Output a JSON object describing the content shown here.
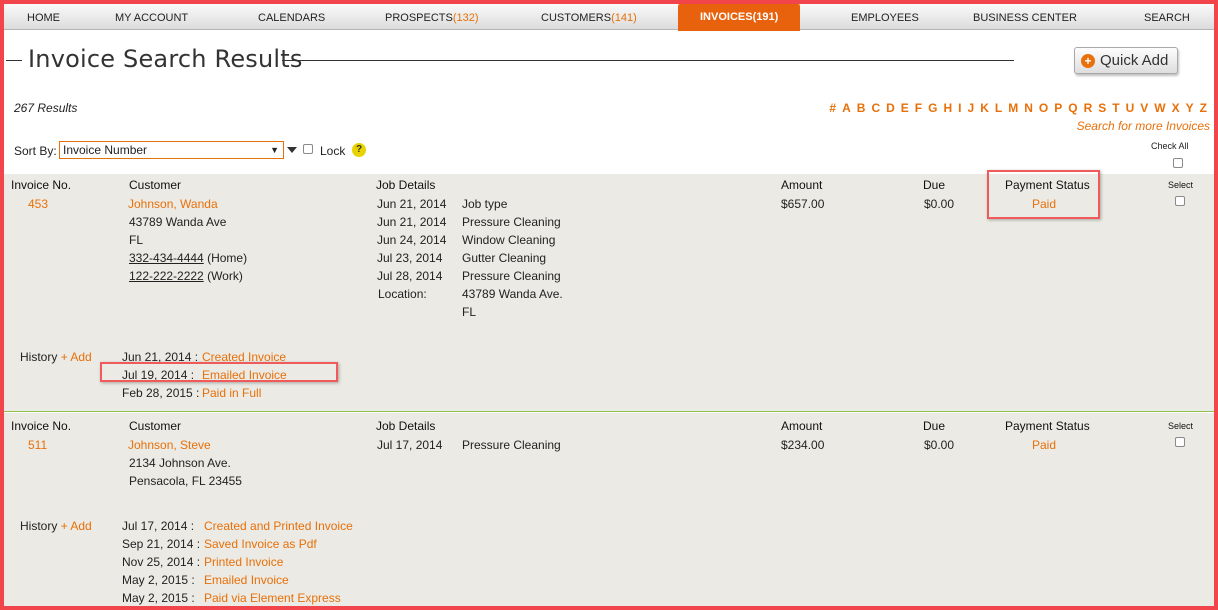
{
  "nav": {
    "items": [
      {
        "label": "HOME",
        "count": ""
      },
      {
        "label": "MY ACCOUNT",
        "count": ""
      },
      {
        "label": "CALENDARS",
        "count": ""
      },
      {
        "label": "PROSPECTS",
        "count": "(132)"
      },
      {
        "label": "CUSTOMERS",
        "count": "(141)"
      },
      {
        "label": "INVOICES",
        "count": "(191)"
      },
      {
        "label": "EMPLOYEES",
        "count": ""
      },
      {
        "label": "BUSINESS CENTER",
        "count": ""
      },
      {
        "label": "SEARCH",
        "count": ""
      }
    ],
    "active": "INVOICES"
  },
  "page": {
    "title": "Invoice Search Results",
    "quick_add": "Quick Add",
    "results_count": "267 Results",
    "alphabet": [
      "#",
      "A",
      "B",
      "C",
      "D",
      "E",
      "F",
      "G",
      "H",
      "I",
      "J",
      "K",
      "L",
      "M",
      "N",
      "O",
      "P",
      "Q",
      "R",
      "S",
      "T",
      "U",
      "V",
      "W",
      "X",
      "Y",
      "Z"
    ],
    "more_link": "Search for more Invoices"
  },
  "sort": {
    "label": "Sort By:",
    "selected": "Invoice Number",
    "lock_label": "Lock",
    "help_icon": "?",
    "check_all": "Check All"
  },
  "columns": {
    "invoice_no": "Invoice No.",
    "customer": "Customer",
    "job_details": "Job Details",
    "amount": "Amount",
    "due": "Due",
    "payment_status": "Payment Status",
    "select": "Select"
  },
  "invoices": [
    {
      "number": "453",
      "customer_name": "Johnson, Wanda",
      "address_lines": [
        "43789 Wanda Ave",
        "FL"
      ],
      "phones": [
        {
          "number": "332-434-4444",
          "type": "(Home)"
        },
        {
          "number": "122-222-2222",
          "type": "(Work)"
        }
      ],
      "jobs": [
        {
          "date": "Jun 21, 2014",
          "type": "Job type"
        },
        {
          "date": "Jun 21, 2014",
          "type": "Pressure Cleaning"
        },
        {
          "date": "Jun 24, 2014",
          "type": "Window Cleaning"
        },
        {
          "date": "Jul 23, 2014",
          "type": "Gutter Cleaning"
        },
        {
          "date": "Jul 28, 2014",
          "type": "Pressure Cleaning"
        }
      ],
      "location_label": "Location:",
      "location_lines": [
        "43789 Wanda Ave.",
        "FL"
      ],
      "amount": "$657.00",
      "due": "$0.00",
      "status": "Paid",
      "history_label": "History",
      "history_add": "+ Add",
      "history": [
        {
          "date": "Jun 21, 2014 :",
          "event": "Created Invoice"
        },
        {
          "date": "Jul 19, 2014 :",
          "event": "Emailed Invoice"
        },
        {
          "date": "Feb 28, 2015 :",
          "event": "Paid in Full"
        }
      ]
    },
    {
      "number": "511",
      "customer_name": "Johnson, Steve",
      "address_lines": [
        "2134 Johnson Ave.",
        "Pensacola, FL 23455"
      ],
      "phones": [],
      "jobs": [
        {
          "date": "Jul 17, 2014",
          "type": "Pressure Cleaning"
        }
      ],
      "amount": "$234.00",
      "due": "$0.00",
      "status": "Paid",
      "history_label": "History",
      "history_add": "+ Add",
      "history": [
        {
          "date": "Jul 17, 2014 :",
          "event": "Created and Printed Invoice"
        },
        {
          "date": "Sep 21, 2014 :",
          "event": "Saved Invoice as Pdf"
        },
        {
          "date": "Nov 25, 2014 :",
          "event": "Printed Invoice"
        },
        {
          "date": "May 2, 2015 :",
          "event": "Emailed Invoice"
        },
        {
          "date": "May 2, 2015 :",
          "event": "Paid via Element Express"
        }
      ]
    }
  ],
  "colors": {
    "accent": "#e8700a",
    "active_tab": "#e8620d",
    "record_bg": "#ebeae4",
    "highlight": "#f05a5a",
    "frame": "#f2444b"
  }
}
